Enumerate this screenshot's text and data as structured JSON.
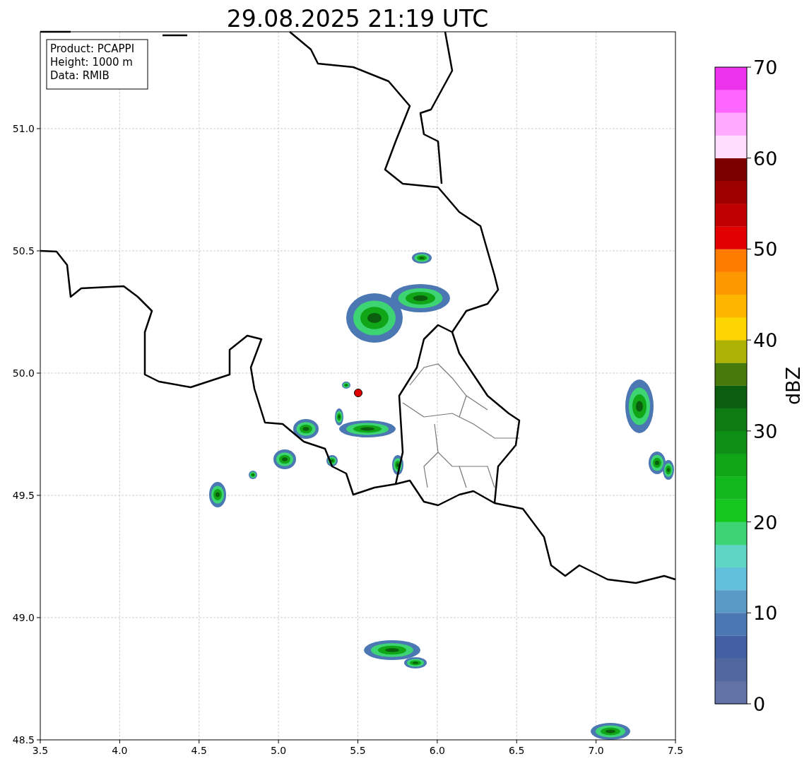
{
  "title": "29.08.2025 21:19 UTC",
  "info_box": [
    "Product: PCAPPI",
    "Height: 1000 m",
    "Data: RMIB"
  ],
  "x_axis": {
    "ticks": [
      "3.5",
      "4.0",
      "4.5",
      "5.0",
      "5.5",
      "6.0",
      "6.5",
      "7.0",
      "7.5"
    ]
  },
  "y_axis": {
    "ticks": [
      "51.0",
      "50.5",
      "50.0",
      "49.5",
      "49.0",
      "48.5"
    ]
  },
  "colorbar": {
    "label": "dBZ",
    "ticks": [
      "70",
      "60",
      "50",
      "40",
      "30",
      "20",
      "10",
      "0"
    ],
    "bins": [
      {
        "color": "#6271a6"
      },
      {
        "color": "#52669f"
      },
      {
        "color": "#4260a3"
      },
      {
        "color": "#4b78b2"
      },
      {
        "color": "#5a9ac6"
      },
      {
        "color": "#63c0dc"
      },
      {
        "color": "#5fd6c5"
      },
      {
        "color": "#3dd574"
      },
      {
        "color": "#14c61e"
      },
      {
        "color": "#12b81d"
      },
      {
        "color": "#10a617"
      },
      {
        "color": "#0f8f16"
      },
      {
        "color": "#0d7a12"
      },
      {
        "color": "#0a5e0e"
      },
      {
        "color": "#477a0a"
      },
      {
        "color": "#adb204"
      },
      {
        "color": "#fdd500"
      },
      {
        "color": "#fdb500"
      },
      {
        "color": "#fe9800"
      },
      {
        "color": "#fe7c00"
      },
      {
        "color": "#e20000"
      },
      {
        "color": "#c00000"
      },
      {
        "color": "#9e0000"
      },
      {
        "color": "#7c0000"
      },
      {
        "color": "#ffddff"
      },
      {
        "color": "#ffaaff"
      },
      {
        "color": "#ff66ff"
      },
      {
        "color": "#ee33ee"
      }
    ]
  }
}
